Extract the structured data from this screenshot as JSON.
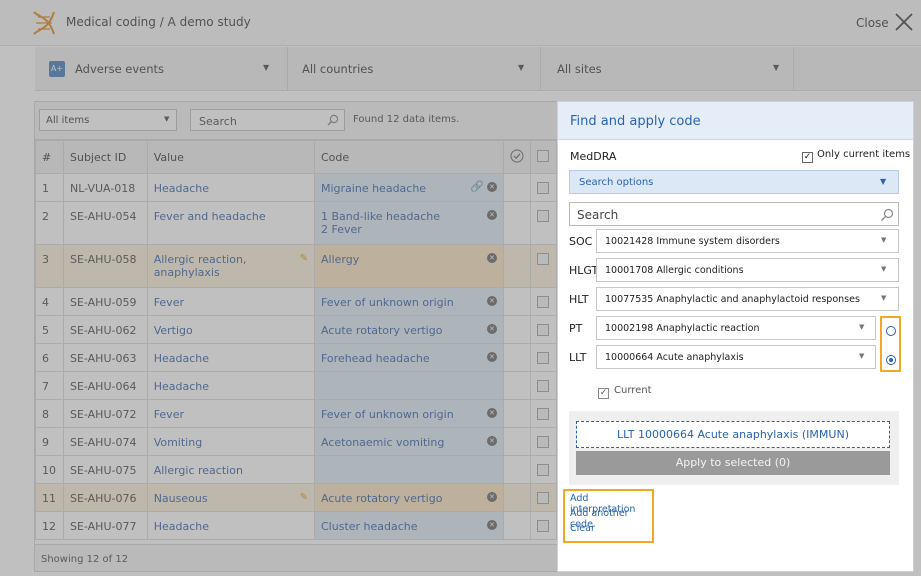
{
  "header": {
    "title": "Medical coding / A demo study",
    "close_label": "Close"
  },
  "filters": {
    "form": "Adverse events",
    "countries": "All countries",
    "sites": "All sites"
  },
  "toolbar": {
    "filter_value": "All items",
    "search_placeholder": "Search",
    "found_text": "Found 12 data items."
  },
  "table": {
    "columns": [
      "#",
      "Subject ID",
      "Value",
      "Code"
    ],
    "rows": [
      {
        "num": "1",
        "subject": "NL-VUA-018",
        "value": "Headache",
        "code": "Migraine headache",
        "code2": ""
      },
      {
        "num": "2",
        "subject": "SE-AHU-054",
        "value": "Fever and headache",
        "code": "1 Band-like headache",
        "code2": "2 Fever"
      },
      {
        "num": "3",
        "subject": "SE-AHU-058",
        "value": "Allergic reaction, anaphylaxis",
        "code": "Allergy",
        "code2": ""
      },
      {
        "num": "4",
        "subject": "SE-AHU-059",
        "value": "Fever",
        "code": "Fever of unknown origin",
        "code2": ""
      },
      {
        "num": "5",
        "subject": "SE-AHU-062",
        "value": "Vertigo",
        "code": "Acute rotatory vertigo",
        "code2": ""
      },
      {
        "num": "6",
        "subject": "SE-AHU-063",
        "value": "Headache",
        "code": "Forehead headache",
        "code2": ""
      },
      {
        "num": "7",
        "subject": "SE-AHU-064",
        "value": "Headache",
        "code": "",
        "code2": ""
      },
      {
        "num": "8",
        "subject": "SE-AHU-072",
        "value": "Fever",
        "code": "Fever of unknown origin",
        "code2": ""
      },
      {
        "num": "9",
        "subject": "SE-AHU-074",
        "value": "Vomiting",
        "code": "Acetonaemic vomiting",
        "code2": ""
      },
      {
        "num": "10",
        "subject": "SE-AHU-075",
        "value": "Allergic reaction",
        "code": "",
        "code2": ""
      },
      {
        "num": "11",
        "subject": "SE-AHU-076",
        "value": "Nauseous",
        "code": "Acute rotatory vertigo",
        "code2": ""
      },
      {
        "num": "12",
        "subject": "SE-AHU-077",
        "value": "Headache",
        "code": "Cluster headache",
        "code2": ""
      }
    ],
    "footer": "Showing 12 of 12"
  },
  "panel": {
    "title": "Find and apply code",
    "dictionary": "MedDRA",
    "only_current": "Only current items",
    "search_options": "Search options",
    "search_placeholder": "Search",
    "hierarchy": [
      {
        "level": "SOC",
        "value": "10021428 Immune system disorders"
      },
      {
        "level": "HLGT",
        "value": "10001708 Allergic conditions"
      },
      {
        "level": "HLT",
        "value": "10077535 Anaphylactic and anaphylactoid responses"
      },
      {
        "level": "PT",
        "value": "10002198 Anaphylactic reaction"
      },
      {
        "level": "LLT",
        "value": "10000664 Acute anaphylaxis"
      }
    ],
    "current_label": "Current",
    "code_button": "LLT 10000664 Acute anaphylaxis (IMMUN)",
    "apply_button": "Apply to selected (0)",
    "links": {
      "add_interpretation": "Add interpretation",
      "add_another_code": "Add another code",
      "clear": "Clear"
    }
  },
  "colors": {
    "accent": "#2a62b0",
    "highlight": "#f5a623",
    "code_cell": "#d9e6f2"
  }
}
